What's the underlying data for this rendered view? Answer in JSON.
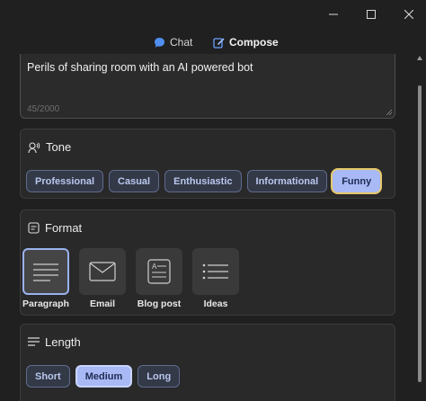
{
  "window": {
    "controls": {
      "minimize_icon": "minimize-icon",
      "maximize_icon": "maximize-icon",
      "close_icon": "close-icon"
    }
  },
  "tabs": [
    {
      "label": "Chat",
      "icon": "chat-bubble-icon",
      "active": false
    },
    {
      "label": "Compose",
      "icon": "compose-pen-icon",
      "active": true
    }
  ],
  "prompt": {
    "value": "Perils of sharing room with an AI powered bot",
    "counter": "45/2000"
  },
  "tone": {
    "title": "Tone",
    "icon": "tone-voice-icon",
    "options": [
      "Professional",
      "Casual",
      "Enthusiastic",
      "Informational",
      "Funny"
    ],
    "selected": "Funny"
  },
  "format": {
    "title": "Format",
    "icon": "format-icon",
    "options": [
      {
        "label": "Paragraph",
        "icon": "paragraph-icon"
      },
      {
        "label": "Email",
        "icon": "email-icon"
      },
      {
        "label": "Blog post",
        "icon": "blog-post-icon"
      },
      {
        "label": "Ideas",
        "icon": "ideas-list-icon"
      }
    ],
    "selected": "Paragraph"
  },
  "length": {
    "title": "Length",
    "icon": "length-icon",
    "options": [
      "Short",
      "Medium",
      "Long"
    ],
    "selected": "Medium"
  },
  "colors": {
    "background": "#202020",
    "card": "#292929",
    "chip_border": "#5d6b8f",
    "chip_text": "#b8c7ee",
    "selected_chip": "#a9b9f6",
    "focus_ring": "#e5c86a",
    "accent": "#7aa7ff"
  }
}
